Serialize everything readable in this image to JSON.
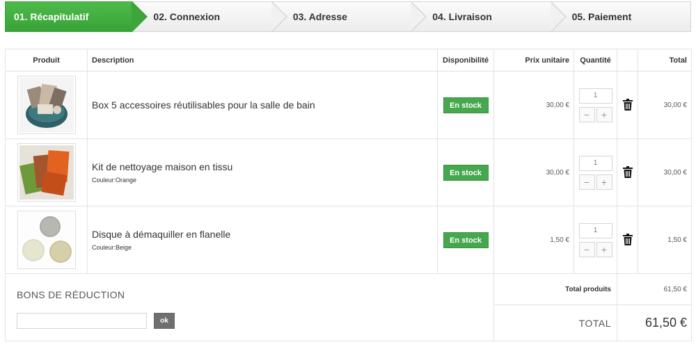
{
  "steps": [
    {
      "label": "01. Récapitulatif",
      "active": true
    },
    {
      "label": "02. Connexion",
      "active": false
    },
    {
      "label": "03. Adresse",
      "active": false
    },
    {
      "label": "04. Livraison",
      "active": false
    },
    {
      "label": "05. Paiement",
      "active": false
    }
  ],
  "table": {
    "headers": {
      "product": "Produit",
      "description": "Description",
      "availability": "Disponibilité",
      "unit_price": "Prix unitaire",
      "quantity": "Quantité",
      "total": "Total"
    }
  },
  "items": [
    {
      "name": "Box 5 accessoires réutilisables pour la salle de bain",
      "attribute": "",
      "stock": "En stock",
      "unit_price": "30,00 €",
      "quantity": "1",
      "total": "30,00 €"
    },
    {
      "name": "Kit de nettoyage maison en tissu",
      "attribute": "Couleur:Orange",
      "stock": "En stock",
      "unit_price": "30,00 €",
      "quantity": "1",
      "total": "30,00 €"
    },
    {
      "name": "Disque à démaquiller en flanelle",
      "attribute": "Couleur:Beige",
      "stock": "En stock",
      "unit_price": "1,50 €",
      "quantity": "1",
      "total": "1,50 €"
    }
  ],
  "qty_controls": {
    "minus": "−",
    "plus": "+"
  },
  "icons": {
    "delete": "trash-icon"
  },
  "vouchers": {
    "title": "BONS DE RÉDUCTION",
    "input_value": "",
    "button": "ok"
  },
  "totals": {
    "products_label": "Total produits",
    "products_value": "61,50 €",
    "grand_label": "TOTAL",
    "grand_value": "61,50 €"
  },
  "colors": {
    "accent": "#46a74e",
    "button_dark": "#6f6f6f"
  }
}
